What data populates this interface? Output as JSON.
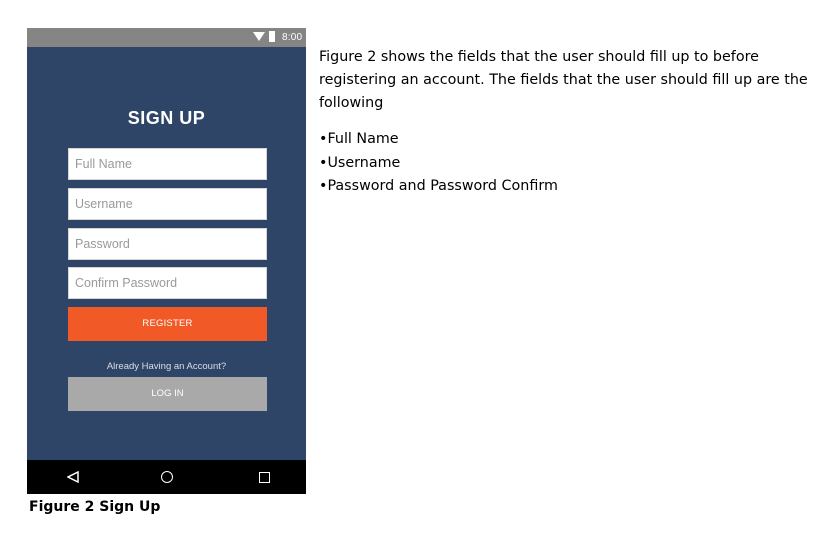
{
  "phone": {
    "status_bar": {
      "time": "8:00",
      "icons": [
        "wifi-icon",
        "battery-icon"
      ]
    },
    "title": "SIGN UP",
    "fields": [
      {
        "placeholder": "Full Name",
        "value": ""
      },
      {
        "placeholder": "Username",
        "value": ""
      },
      {
        "placeholder": "Password",
        "value": ""
      },
      {
        "placeholder": "Confirm Password",
        "value": ""
      }
    ],
    "register_label": "REGISTER",
    "already_text": "Already Having an Account?",
    "login_label": "LOG IN",
    "nav_icons": [
      "back-icon",
      "home-icon",
      "recent-apps-icon"
    ],
    "colors": {
      "background": "#2f4568",
      "register": "#f15a26",
      "login": "#a9a9a9",
      "status_bar": "#858585"
    }
  },
  "caption": "Figure 2 Sign Up",
  "description": "Figure 2 shows the fields that the user should fill up to before registering an account. The fields that the user should fill up are the following",
  "bullets": [
    "Full Name",
    "Username",
    "Password and Password Confirm"
  ]
}
